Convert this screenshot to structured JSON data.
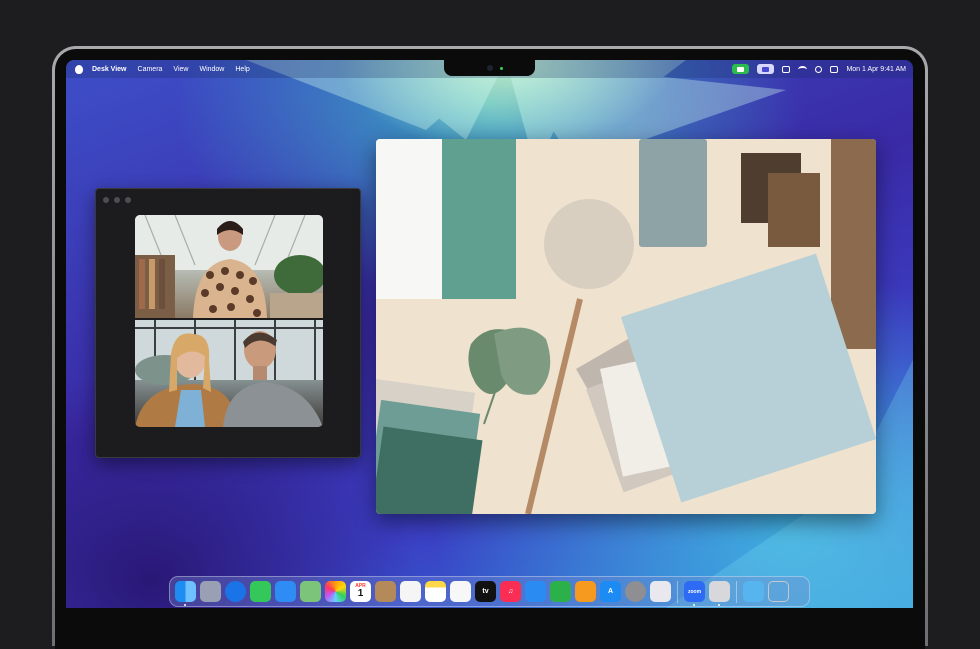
{
  "menubar": {
    "app_name": "Desk View",
    "menus": [
      "Camera",
      "View",
      "Window",
      "Help"
    ],
    "clock": "Mon 1 Apr  9:41 AM"
  },
  "dock": {
    "apps": [
      {
        "name": "finder-icon",
        "color": "#1e8cf0"
      },
      {
        "name": "launchpad-icon",
        "color": "#9aa0b4"
      },
      {
        "name": "safari-icon",
        "color": "#1a74e8"
      },
      {
        "name": "messages-icon",
        "color": "#34c759"
      },
      {
        "name": "mail-icon",
        "color": "#2f8cf5"
      },
      {
        "name": "maps-icon",
        "color": "#7cc47a"
      },
      {
        "name": "photos-icon",
        "color": "#f4f4f4"
      },
      {
        "name": "calendar-icon",
        "color": "#ffffff"
      },
      {
        "name": "contacts-icon",
        "color": "#b58a5a"
      },
      {
        "name": "reminders-icon",
        "color": "#f5f5f5"
      },
      {
        "name": "notes-icon",
        "color": "#ffd84a"
      },
      {
        "name": "freeform-icon",
        "color": "#f7f7f7"
      },
      {
        "name": "tv-icon",
        "color": "#111111"
      },
      {
        "name": "music-icon",
        "color": "#fa2d55"
      },
      {
        "name": "keynote-icon",
        "color": "#2a8bf2"
      },
      {
        "name": "numbers-icon",
        "color": "#2cb14a"
      },
      {
        "name": "pages-icon",
        "color": "#f59a1e"
      },
      {
        "name": "app-store-icon",
        "color": "#1c8cf4"
      },
      {
        "name": "system-settings-icon",
        "color": "#8e8e93"
      },
      {
        "name": "iphone-mirroring-icon",
        "color": "#e8e8ee"
      }
    ],
    "calendar_month": "APR",
    "calendar_day": "1",
    "tv_label": "tv",
    "extra": [
      {
        "name": "zoom-icon",
        "color": "#2d6bf5",
        "label": "zoom"
      },
      {
        "name": "desk-view-icon",
        "color": "#d8d8dc"
      }
    ],
    "trailing": [
      {
        "name": "downloads-folder-icon",
        "color": "#57b4ee"
      },
      {
        "name": "trash-icon",
        "color": "#9a9aa0"
      }
    ]
  }
}
